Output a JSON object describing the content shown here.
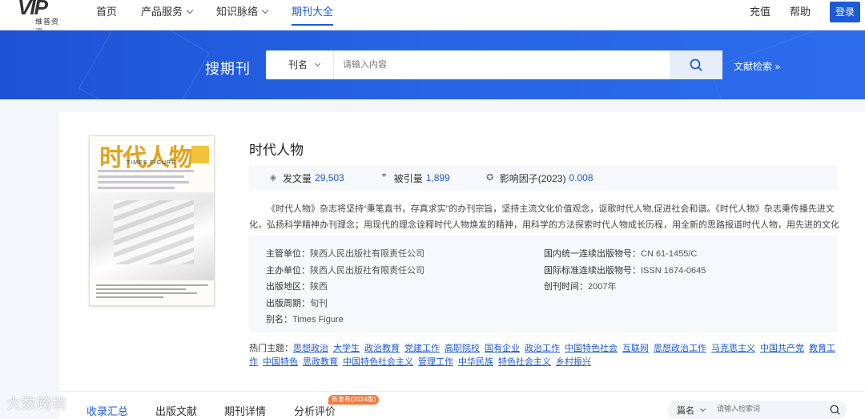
{
  "logo": {
    "mark": "VIP",
    "sub": "维普资讯"
  },
  "nav": {
    "items": [
      {
        "label": "首页",
        "chevron": false,
        "active": false
      },
      {
        "label": "产品服务",
        "chevron": true,
        "active": false
      },
      {
        "label": "知识脉络",
        "chevron": true,
        "active": false
      },
      {
        "label": "期刊大全",
        "chevron": false,
        "active": true
      }
    ]
  },
  "top_right": {
    "recharge": "充值",
    "help": "帮助",
    "login": "登录"
  },
  "banner": {
    "title": "搜期刊",
    "search_type": "刊名",
    "search_placeholder": "请输入内容",
    "advanced": "文献检索 »"
  },
  "cover": {
    "title": "时代人物",
    "sub": "TIMES FIGURE"
  },
  "journal": {
    "title": "时代人物",
    "stats": [
      {
        "icon": "stack-icon",
        "label": "发文量",
        "value": "29,503"
      },
      {
        "icon": "quote-icon",
        "label": "被引量",
        "value": "1,899"
      },
      {
        "icon": "impact-icon",
        "label": "影响因子(2023)",
        "value": "0.008"
      }
    ],
    "description": "《时代人物》杂志将坚持“秉笔直书，存真求实”的办刊宗旨，坚持主流文化价值观念，讴歌时代人物,促进社会和谐。《时代人物》杂志秉传播先进文化，弘扬科学精神办刊理念；用现代的理念诠释时代人物焕发的精神，用科学的方法探索时代人物成长历程，用全新的思路报道时代人物，用先进的文化打造时代人物。",
    "info_left": [
      {
        "k": "主管单位：",
        "v": "陕西人民出版社有限责任公司"
      },
      {
        "k": "主办单位：",
        "v": "陕西人民出版社有限责任公司"
      },
      {
        "k": "出版地区：",
        "v": "陕西"
      },
      {
        "k": "出版周期：",
        "v": "旬刊"
      },
      {
        "k": "别名：",
        "v": "Times Figure"
      }
    ],
    "info_right": [
      {
        "k": "国内统一连续出版物号：",
        "v": "CN 61-1455/C"
      },
      {
        "k": "国际标准连续出版物号：",
        "v": "ISSN 1674-0645"
      },
      {
        "k": "创刊时间：",
        "v": "2007年"
      }
    ],
    "hot_label": "热门主题：",
    "hot_topics": [
      "思想政治",
      "大学生",
      "政治教育",
      "党建工作",
      "高职院校",
      "国有企业",
      "政治工作",
      "中国特色社会",
      "互联网",
      "思想政治工作",
      "马克思主义",
      "中国共产党",
      "教育工作",
      "中国特色",
      "思政教育",
      "中国特色社会主义",
      "管理工作",
      "中华民族",
      "特色社会主义",
      "乡村振兴"
    ]
  },
  "tabs": {
    "items": [
      "收录汇总",
      "出版文献",
      "期刊详情",
      "分析评价"
    ],
    "new_badge": "新发布(2024版)"
  },
  "bottom_search": {
    "type": "篇名",
    "placeholder": "请输入检索词"
  },
  "watermark": "大数跨境"
}
